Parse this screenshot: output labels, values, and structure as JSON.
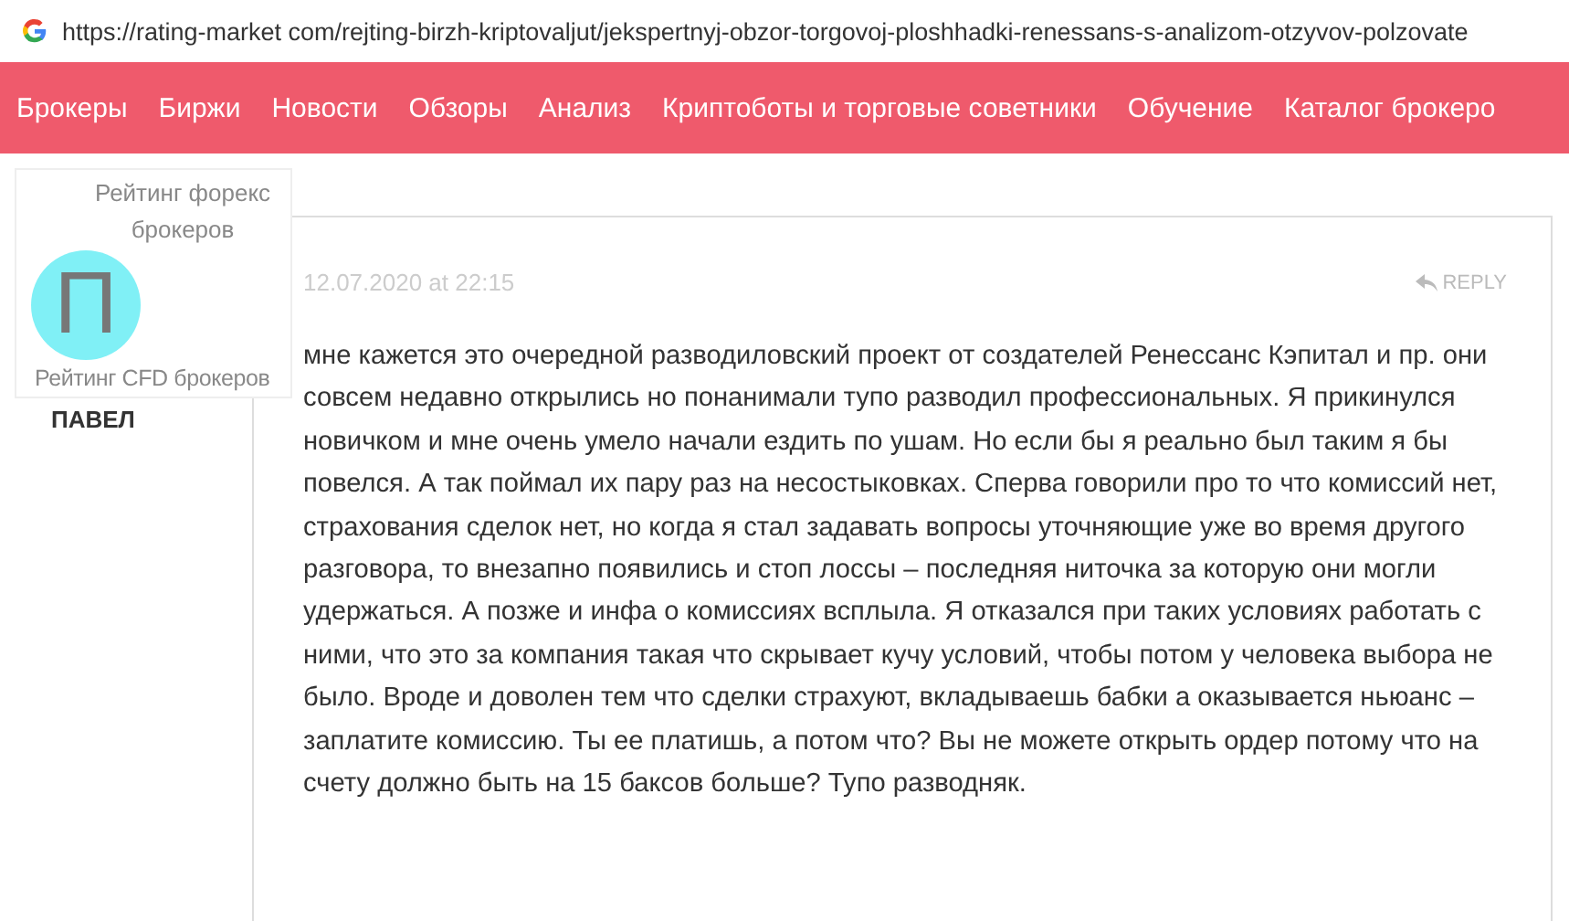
{
  "address_bar": {
    "url": "https://rating-market com/rejting-birzh-kriptovaljut/jekspertnyj-obzor-torgovoj-ploshhadki-renessans-s-analizom-otzyvov-polzovate"
  },
  "nav": [
    "Брокеры",
    "Биржи",
    "Новости",
    "Обзоры",
    "Анализ",
    "Криптоботы и торговые советники",
    "Обучение",
    "Каталог брокеро"
  ],
  "popup": {
    "items": [
      "Рейтинг форекс брокеров",
      "Рейтинг CFD брокеров"
    ]
  },
  "comment": {
    "avatar_letter": "П",
    "author": "ПАВЕЛ",
    "date": "12.07.2020 at 22:15",
    "reply": "REPLY",
    "text": "мне кажется это очередной разводиловский проект от создателей Ренессанс Кэпитал и пр. они совсем недавно открылись но понанимали тупо разводил профессиональных. Я прикинулся новичком и мне очень умело начали ездить по ушам. Но если бы я реально был таким я бы повелся. А так поймал их пару раз на несостыковках. Сперва говорили про то что комиссий нет, страхования сделок нет, но когда я стал задавать вопросы уточняющие уже во время другого разговора, то внезапно появились и стоп лоссы – последняя ниточка за которую они могли удержаться. А позже и инфа о комиссиях всплыла. Я отказался при таких условиях работать с ними, что это за компания такая что скрывает кучу условий, чтобы потом у человека выбора не было. Вроде и доволен тем что сделки страхуют, вкладываешь бабки а оказывается ньюанс – заплатите комиссию. Ты ее платишь, а потом что? Вы не можете открыть ордер потому что на счету должно быть на 15 баксов больше? Тупо разводняк."
  }
}
